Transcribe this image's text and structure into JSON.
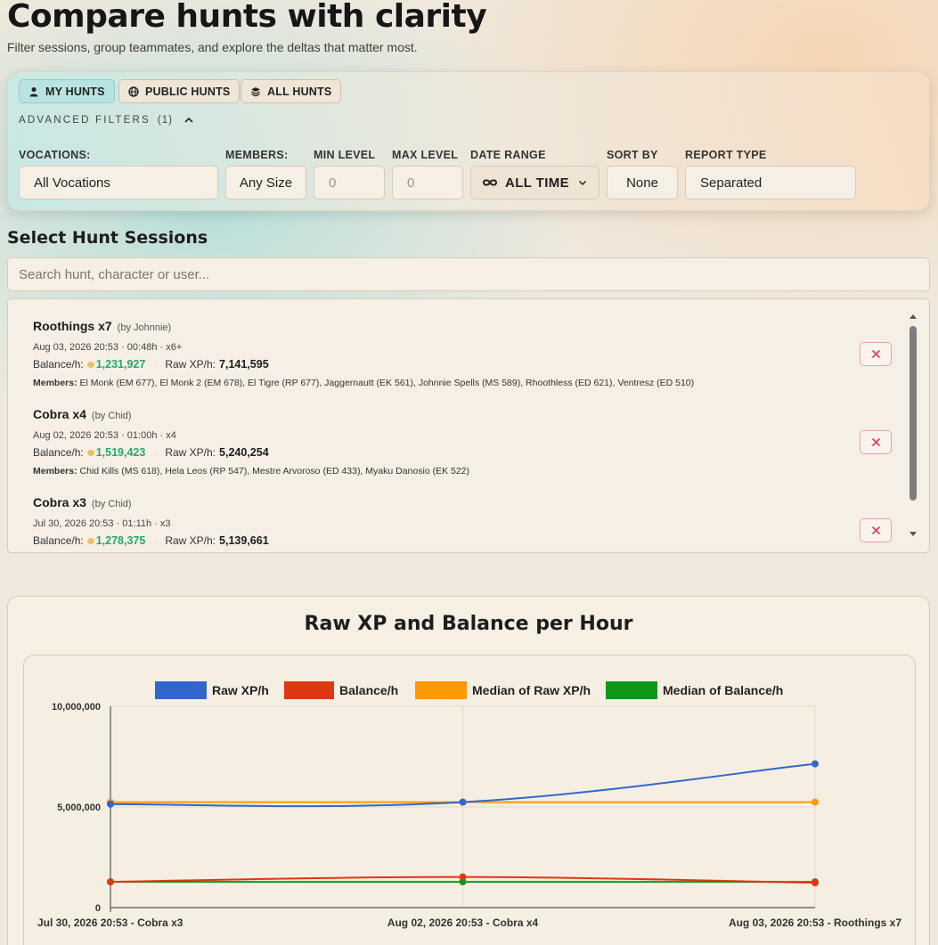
{
  "page": {
    "title": "Compare hunts with clarity",
    "subtitle": "Filter sessions, group teammates, and explore the deltas that matter most."
  },
  "scope_tabs": [
    {
      "label": "MY HUNTS",
      "icon": "user-icon",
      "active": true
    },
    {
      "label": "PUBLIC HUNTS",
      "icon": "globe-icon",
      "active": false
    },
    {
      "label": "ALL HUNTS",
      "icon": "layers-icon",
      "active": false
    }
  ],
  "advanced_filters": {
    "label": "ADVANCED FILTERS",
    "count": "(1)",
    "expanded": true
  },
  "filters": {
    "vocations": {
      "label": "VOCATIONS:",
      "value": "All Vocations"
    },
    "members": {
      "label": "MEMBERS:",
      "value": "Any Size"
    },
    "min_level": {
      "label": "MIN LEVEL",
      "placeholder": "0"
    },
    "max_level": {
      "label": "MAX LEVEL",
      "placeholder": "0"
    },
    "date_range": {
      "label": "DATE RANGE",
      "value": "ALL TIME",
      "icon": "infinity-icon"
    },
    "sort_by": {
      "label": "SORT BY",
      "value": "None"
    },
    "report_type": {
      "label": "REPORT TYPE",
      "value": "Separated"
    }
  },
  "sessions_section": {
    "title": "Select Hunt Sessions",
    "search_placeholder": "Search hunt, character or user..."
  },
  "sessions": [
    {
      "name": "Roothings x7",
      "by": "(by Johnnie)",
      "meta": "Aug 03, 2026 20:53 · 00:48h · x6+",
      "balance_label": "Balance/h:",
      "balance": "1,231,927",
      "xp_label": "Raw XP/h:",
      "xp": "7,141,595",
      "members_label": "Members:",
      "members": "El Monk (EM 677), El Monk 2 (EM 678), El Tigre (RP 677), Jaggernautt (EK 561), Johnnie Spells (MS 589), Rhoothless (ED 621), Ventresz (ED 510)"
    },
    {
      "name": "Cobra x4",
      "by": "(by Chid)",
      "meta": "Aug 02, 2026 20:53 · 01:00h · x4",
      "balance_label": "Balance/h:",
      "balance": "1,519,423",
      "xp_label": "Raw XP/h:",
      "xp": "5,240,254",
      "members_label": "Members:",
      "members": "Chid Kills (MS 618), Hela Leos (RP 547), Mestre Arvoroso (ED 433), Myaku Danosio (EK 522)"
    },
    {
      "name": "Cobra x3",
      "by": "(by Chid)",
      "meta": "Jul 30, 2026 20:53 · 01:11h · x3",
      "balance_label": "Balance/h:",
      "balance": "1,278,375",
      "xp_label": "Raw XP/h:",
      "xp": "5,139,661",
      "members_label": "",
      "members": ""
    }
  ],
  "chart_data": {
    "type": "line",
    "title": "Raw XP and Balance per Hour",
    "categories": [
      "Jul 30, 2026 20:53 - Cobra x3",
      "Aug 02, 2026 20:53 - Cobra x4",
      "Aug 03, 2026 20:53 - Roothings x7"
    ],
    "series": [
      {
        "name": "Raw XP/h",
        "color": "#3366cc",
        "values": [
          5139661,
          5240254,
          7141595
        ]
      },
      {
        "name": "Balance/h",
        "color": "#dc3912",
        "values": [
          1278375,
          1519423,
          1231927
        ]
      },
      {
        "name": "Median of Raw XP/h",
        "color": "#ff9900",
        "values": [
          5240254,
          5240254,
          5240254
        ]
      },
      {
        "name": "Median of Balance/h",
        "color": "#109618",
        "values": [
          1278375,
          1278375,
          1278375
        ]
      }
    ],
    "ylim": [
      0,
      10000000
    ],
    "yticks": [
      "0",
      "5,000,000",
      "10,000,000"
    ],
    "grid": true,
    "legend": "top"
  }
}
